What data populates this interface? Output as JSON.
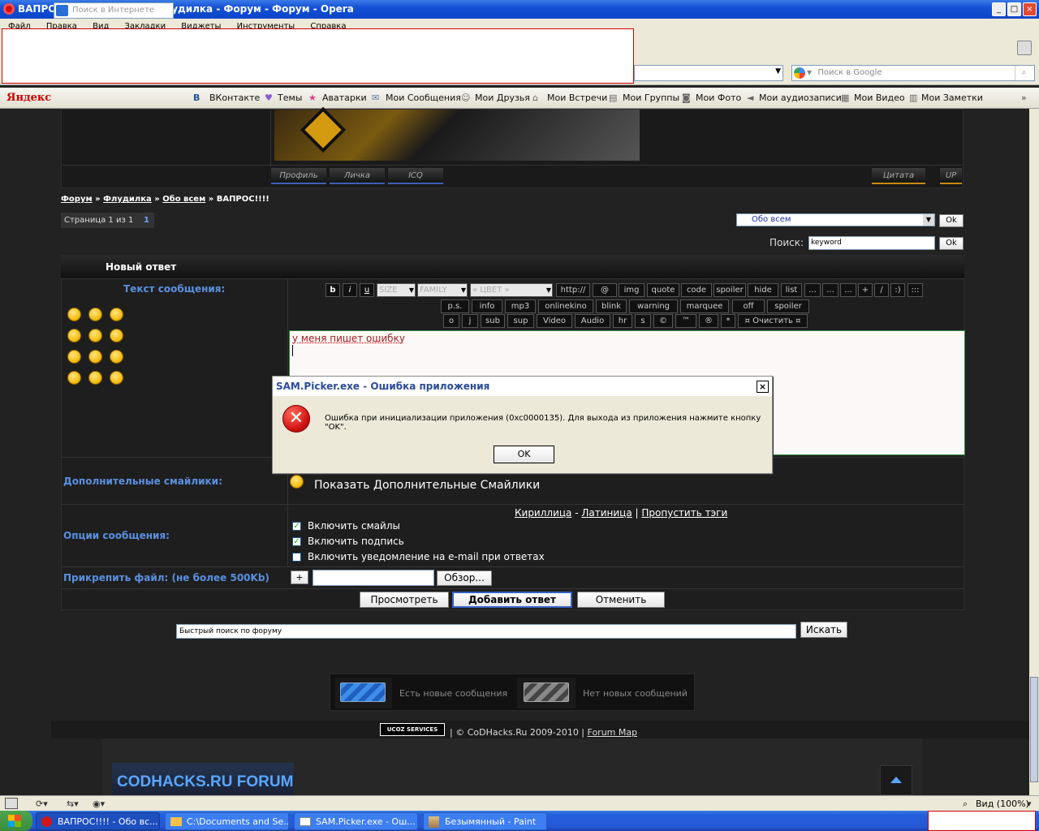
{
  "window": {
    "title": "ВАПРОС!!!! - Обо всем - Флудилка - Форум - Форум - Opera"
  },
  "menu": [
    "Файл",
    "Правка",
    "Вид",
    "Закладки",
    "Виджеты",
    "Инструменты",
    "Справка"
  ],
  "google_search": {
    "placeholder": "Поиск в Google"
  },
  "yandex_bar": {
    "logo": "Яндекс",
    "search_placeholder": "Поиск в Интернете",
    "items": [
      "ВКонтакте",
      "Темы",
      "Аватарки",
      "Мои Сообщения",
      "Мои Друзья",
      "Мои Встречи",
      "Мои Группы",
      "Мои Фото",
      "Мои аудиозаписи",
      "Мои Видео",
      "Мои Заметки"
    ]
  },
  "post": {
    "buttons": [
      "Профиль",
      "Личка",
      "ICQ"
    ],
    "right_buttons": [
      "Цитата",
      "UP"
    ]
  },
  "breadcrumb": {
    "items": [
      "Форум",
      "Флудилка",
      "Обо всем"
    ],
    "current": "ВАПРОС!!!!",
    "sep": "»"
  },
  "pager": {
    "text": "Страница 1 из 1",
    "page": "1"
  },
  "forum_select": {
    "value": "Обо всем",
    "ok": "Ok"
  },
  "search": {
    "label": "Поиск:",
    "value": "keyword",
    "ok": "Ok"
  },
  "reply": {
    "header": "Новый ответ",
    "text_label": "Текст сообщения:",
    "toolbar_row1": [
      "b",
      "i",
      "u"
    ],
    "size_select": "SIZE",
    "family_select": "FAMILY",
    "color_select": "« ЦВЕТ »",
    "toolbar_row1b": [
      "http://",
      "@",
      "img",
      "quote",
      "code",
      "spoiler",
      "hide",
      "list",
      "...",
      "...",
      "...",
      "+",
      "/",
      ":)",
      ":::"
    ],
    "toolbar_row2": [
      "p.s.",
      "info",
      "mp3",
      "onlinekino",
      "blink",
      "warning",
      "marquee",
      "off",
      "spoiler"
    ],
    "toolbar_row3": [
      "o",
      "j",
      "sub",
      "sup",
      "Video",
      "Audio",
      "hr",
      "s",
      "©",
      "™",
      "®",
      "*",
      "¤ Очистить ¤"
    ],
    "message_text": "у меня пишет ошибку",
    "extra_smileys_label": "Дополнительные смайлики:",
    "extra_smileys_link": "Показать Дополнительные Смайлики",
    "options_label": "Опции сообщения:",
    "translit_links": [
      "Кириллица",
      "Латиница",
      "Пропустить тэги"
    ],
    "options": [
      {
        "label": "Включить смайлы",
        "checked": true
      },
      {
        "label": "Включить подпись",
        "checked": true
      },
      {
        "label": "Включить уведомление на e-mail при ответах",
        "checked": false
      }
    ],
    "attach_label": "Прикрепить файл: (не более 500Kb)",
    "attach_plus": "+",
    "browse": "Обзор...",
    "actions": [
      "Просмотреть",
      "Добавить ответ",
      "Отменить"
    ]
  },
  "quick_search": {
    "value": "Быстрый поиск по форуму",
    "button": "Искать"
  },
  "legend": {
    "new_posts": "Есть новые сообщения",
    "no_new_posts": "Нет новых сообщений"
  },
  "footer": {
    "ucoz": "UCOZ SERVICES",
    "copyright": "| © CoDHacks.Ru 2009-2010 |",
    "forum_map": "Forum Map",
    "logo": "CODHACKS.RU FORUM"
  },
  "dialog": {
    "title": "SAM.Picker.exe - Ошибка приложения",
    "message": "Ошибка при инициализации приложения (0xc0000135). Для выхода из приложения нажмите кнопку \"OK\".",
    "ok": "OK",
    "close": "×"
  },
  "status": {
    "zoom": "Вид (100%)"
  },
  "taskbar": {
    "items": [
      "ВАПРОС!!!! - Обо вс...",
      "C:\\Documents and Se...",
      "SAM.Picker.exe - Ош...",
      "Безымянный - Paint"
    ]
  }
}
